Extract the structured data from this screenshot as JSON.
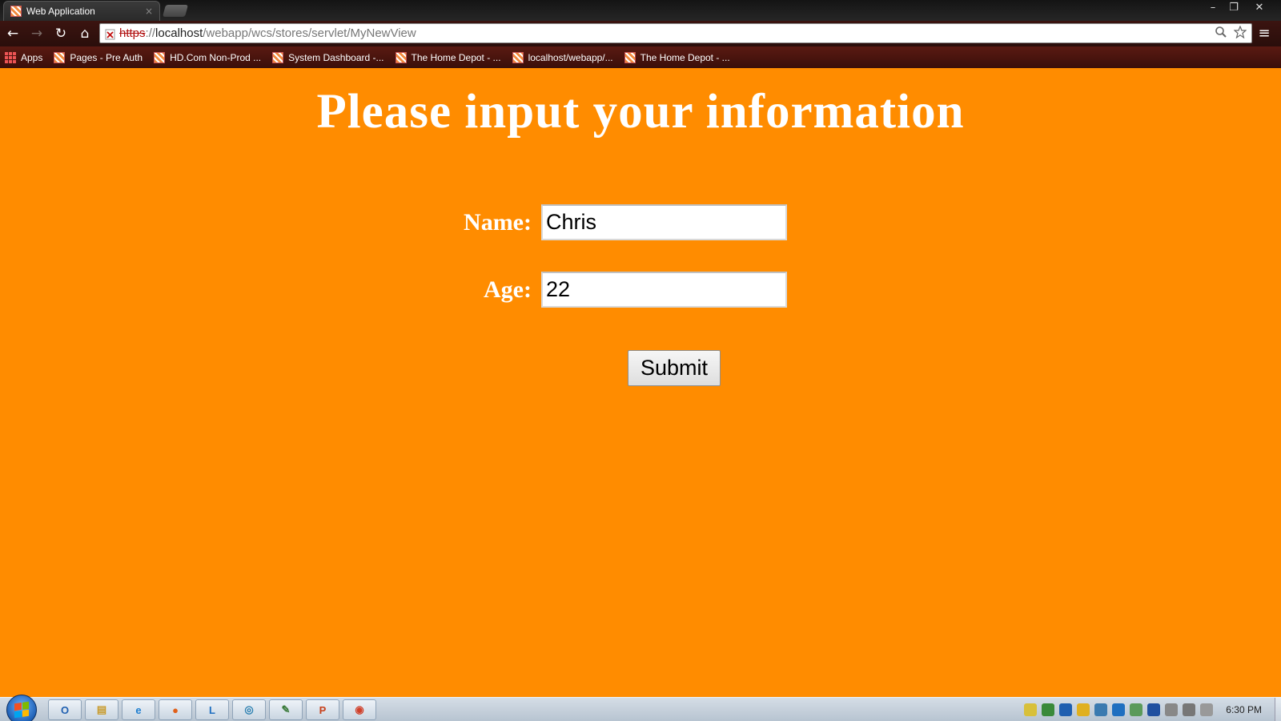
{
  "browser": {
    "tab_title": "Web Application",
    "tab_close": "×",
    "url": {
      "scheme": "https",
      "separator": "://",
      "host": "localhost",
      "path": "/webapp/wcs/stores/servlet/MyNewView"
    },
    "window_controls": {
      "minimize": "–",
      "restore": "❐",
      "close": "✕"
    },
    "nav": {
      "back": "←",
      "forward": "→",
      "reload": "↻",
      "home": "⌂"
    },
    "menu_icon": "≡",
    "bookmarks": [
      {
        "label": "Apps",
        "icon": "apps-grid-icon"
      },
      {
        "label": "Pages - Pre Auth",
        "icon": "homedepot-favicon"
      },
      {
        "label": "HD.Com Non-Prod ...",
        "icon": "homedepot-favicon"
      },
      {
        "label": "System Dashboard -...",
        "icon": "homedepot-favicon"
      },
      {
        "label": "The Home Depot - ...",
        "icon": "homedepot-favicon"
      },
      {
        "label": "localhost/webapp/...",
        "icon": "homedepot-favicon"
      },
      {
        "label": "The Home Depot - ...",
        "icon": "homedepot-favicon"
      }
    ]
  },
  "page": {
    "heading": "Please input your information",
    "form": {
      "name_label": "Name:",
      "name_value": "Chris",
      "age_label": "Age:",
      "age_value": "22",
      "submit_label": "Submit"
    },
    "background_color": "#ff8c00"
  },
  "taskbar": {
    "pinned": [
      {
        "name": "outlook",
        "glyph": "O",
        "color": "#1f5fb0"
      },
      {
        "name": "explorer",
        "glyph": "▤",
        "color": "#c89a2a"
      },
      {
        "name": "internet-explorer",
        "glyph": "e",
        "color": "#1f7fd0"
      },
      {
        "name": "firefox",
        "glyph": "●",
        "color": "#e0601a"
      },
      {
        "name": "lync",
        "glyph": "L",
        "color": "#1f6fc0"
      },
      {
        "name": "app-circle",
        "glyph": "◎",
        "color": "#2a7fb0"
      },
      {
        "name": "notepad",
        "glyph": "✎",
        "color": "#3a7a3a"
      },
      {
        "name": "powerpoint",
        "glyph": "P",
        "color": "#c8401a"
      },
      {
        "name": "chrome",
        "glyph": "◉",
        "color": "#d0402a"
      }
    ],
    "clock": "6:30 PM"
  }
}
